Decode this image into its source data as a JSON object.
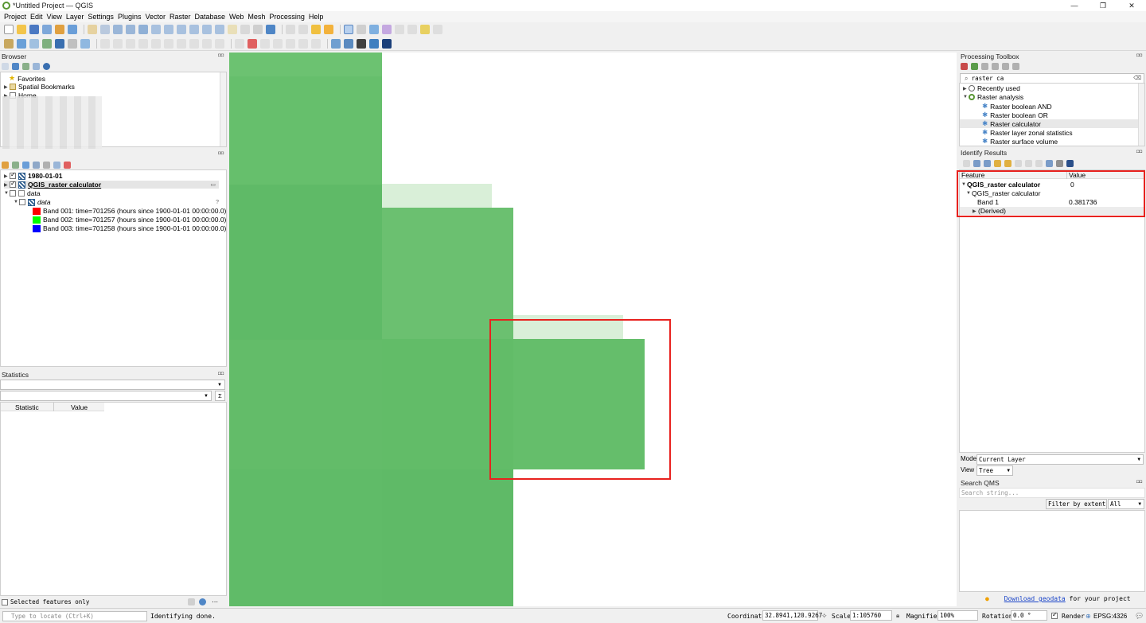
{
  "window": {
    "title": "*Untitled Project — QGIS",
    "minimize": "—",
    "maximize": "❐",
    "close": "✕"
  },
  "menu": [
    "Project",
    "Edit",
    "View",
    "Layer",
    "Settings",
    "Plugins",
    "Vector",
    "Raster",
    "Database",
    "Web",
    "Mesh",
    "Processing",
    "Help"
  ],
  "browser": {
    "title": "Browser",
    "items": [
      "Favorites",
      "Spatial Bookmarks",
      "Home"
    ]
  },
  "layers": {
    "items": [
      {
        "label": "1980-01-01"
      },
      {
        "label": "QGIS_raster calculator"
      },
      {
        "label": "data"
      },
      {
        "label": "data"
      }
    ],
    "bands": [
      {
        "label": "Band 001: time=701256 (hours since 1900-01-01 00:00:00.0)",
        "color": "#ff0000"
      },
      {
        "label": "Band 002: time=701257 (hours since 1900-01-01 00:00:00.0)",
        "color": "#00ff00"
      },
      {
        "label": "Band 003: time=701258 (hours since 1900-01-01 00:00:00.0)",
        "color": "#0000ff"
      }
    ],
    "help": "?"
  },
  "statistics": {
    "title": "Statistics",
    "col_statistic": "Statistic",
    "col_value": "Value",
    "sigma": "Σ"
  },
  "selected_features": {
    "label": "Selected features only",
    "more": "⋯"
  },
  "processing_toolbox": {
    "title": "Processing Toolbox",
    "search_value": "raster ca",
    "recently_used": "Recently used",
    "group": "Raster analysis",
    "algorithms": [
      "Raster boolean AND",
      "Raster boolean OR",
      "Raster calculator",
      "Raster layer zonal statistics",
      "Raster surface volume"
    ]
  },
  "identify": {
    "title": "Identify Results",
    "col_feature": "Feature",
    "col_value": "Value",
    "rows": [
      {
        "feature": "QGIS_raster calculator",
        "value": "0"
      },
      {
        "feature": "QGIS_raster calculator",
        "value": ""
      },
      {
        "feature": "Band 1",
        "value": "0.381736"
      },
      {
        "feature": "(Derived)",
        "value": ""
      }
    ],
    "mode_label": "Mode",
    "mode_value": "Current Layer",
    "view_label": "View",
    "view_value": "Tree"
  },
  "search_qms": {
    "title": "Search QMS",
    "placeholder": "Search string...",
    "filter_label": "Filter by extent",
    "filter_value": "All",
    "download_link": "Download geodata",
    "download_suffix": " for your project"
  },
  "statusbar": {
    "locate_placeholder": "Type to locate (Ctrl+K)",
    "message": "Identifying done.",
    "coordinate_label": "Coordinate",
    "coordinate_value": "32.8941,120.9267",
    "scale_label": "Scale",
    "scale_value": "1:105760",
    "magnifier_label": "Magnifier",
    "magnifier_value": "100%",
    "rotation_label": "Rotation",
    "rotation_value": "0.0 °",
    "render_label": "Render",
    "crs": "EPSG:4326"
  },
  "colors": {
    "raster_green": "#5cb865",
    "raster_light": "#d9efd8",
    "highlight_red": "#e8221f",
    "link_blue": "#1a44c8"
  }
}
